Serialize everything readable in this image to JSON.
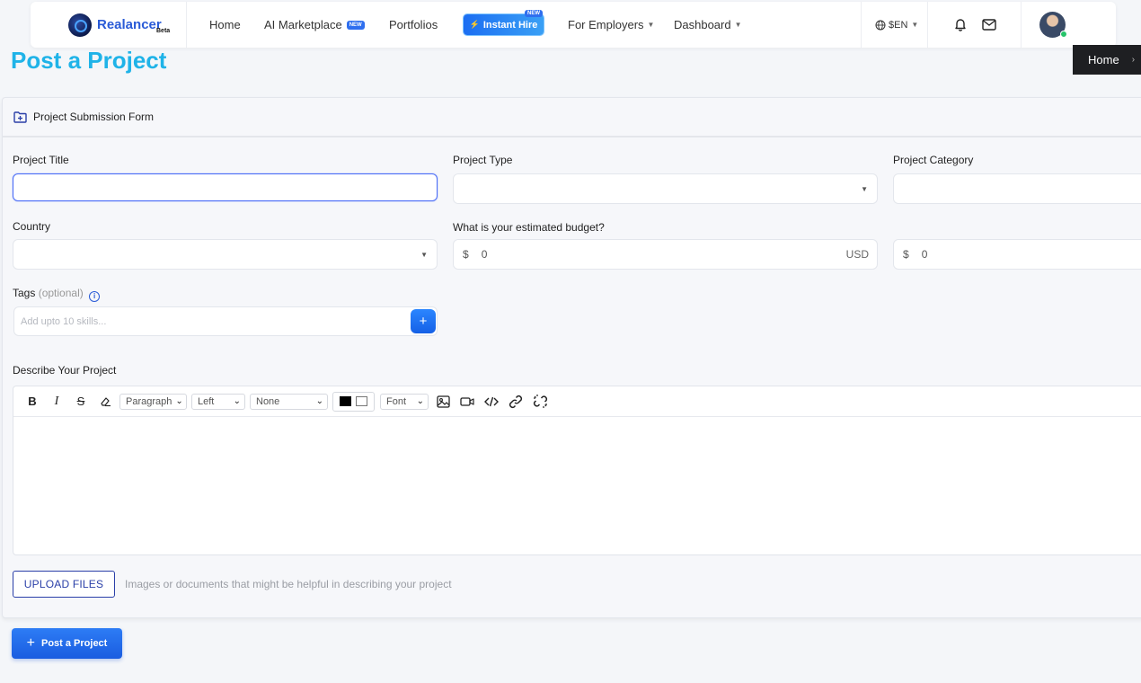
{
  "nav": {
    "brand": "Realancer",
    "brand_beta": "Beta",
    "home": "Home",
    "ai_marketplace": "AI Marketplace",
    "ai_badge": "NEW",
    "portfolios": "Portfolios",
    "instant_hire": "Instant Hire",
    "instant_badge": "NEW",
    "for_employers": "For Employers",
    "dashboard": "Dashboard",
    "lang": "$EN"
  },
  "page": {
    "title": "Post a Project",
    "breadcrumb_home": "Home"
  },
  "form": {
    "header": "Project Submission Form",
    "project_title_label": "Project Title",
    "project_title_value": "",
    "project_type_label": "Project Type",
    "project_category_label": "Project Category",
    "country_label": "Country",
    "budget_label": "What is your estimated budget?",
    "budget_currency_symbol": "$",
    "budget_value": "0",
    "budget_currency": "USD",
    "budget2_currency_symbol": "$",
    "budget2_value": "0",
    "tags_label": "Tags",
    "tags_optional": "(optional)",
    "tags_placeholder": "Add upto 10 skills...",
    "tags_add": "+",
    "describe_label": "Describe Your Project",
    "upload_label": "UPLOAD FILES",
    "upload_hint": "Images or documents that might be helpful in describing your project",
    "post_button": "Post a Project"
  },
  "editor": {
    "toolbar": {
      "bold": "B",
      "italic": "I",
      "strike": "S",
      "paragraph": "Paragraph",
      "align": "Left",
      "list": "None",
      "font": "Font"
    }
  },
  "colors": {
    "primary": "#2a5bd7",
    "title": "#1fb3e8",
    "button": "#1a5de0"
  }
}
